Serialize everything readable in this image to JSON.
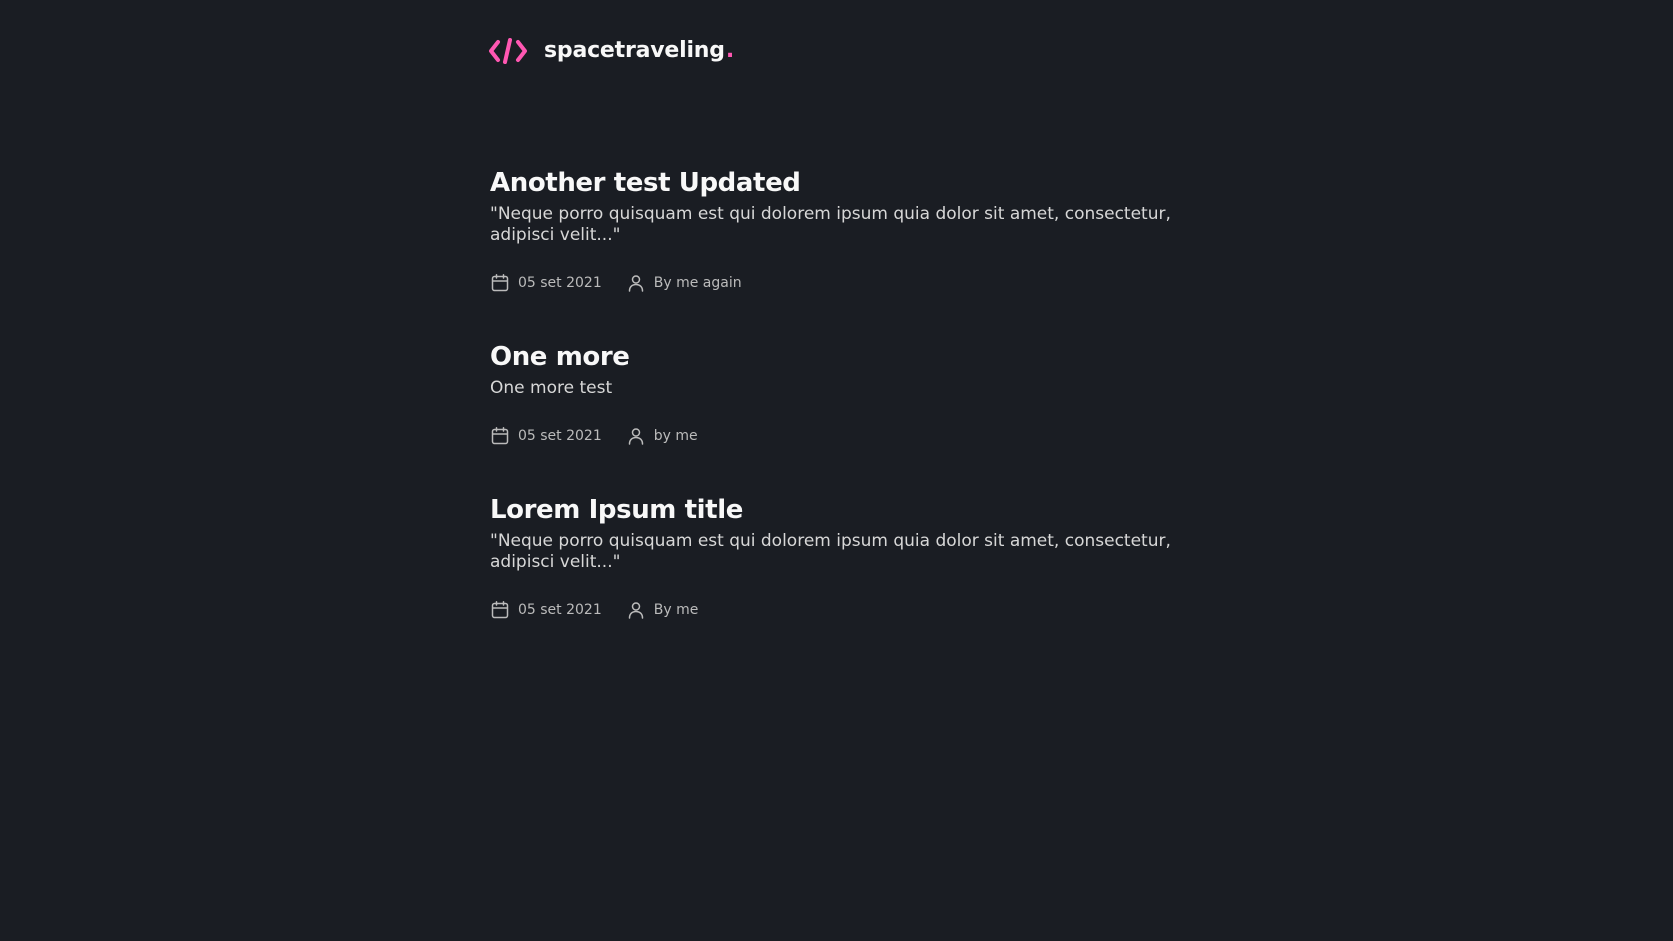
{
  "header": {
    "logo_text": "spacetraveling",
    "logo_dot": ".",
    "logo_icon": "code-brackets-icon",
    "accent_color": "#ff57b2"
  },
  "posts": [
    {
      "title": "Another test Updated",
      "subtitle": "\"Neque porro quisquam est qui dolorem ipsum quia dolor sit amet, consectetur, adipisci velit...\"",
      "date": "05 set 2021",
      "author": "By me again",
      "date_icon": "calendar-icon",
      "author_icon": "user-icon"
    },
    {
      "title": "One more",
      "subtitle": "One more test",
      "date": "05 set 2021",
      "author": "by me",
      "date_icon": "calendar-icon",
      "author_icon": "user-icon"
    },
    {
      "title": "Lorem Ipsum title",
      "subtitle": "\"Neque porro quisquam est qui dolorem ipsum quia dolor sit amet, consectetur, adipisci velit...\"",
      "date": "05 set 2021",
      "author": "By me",
      "date_icon": "calendar-icon",
      "author_icon": "user-icon"
    }
  ],
  "colors": {
    "background": "#1a1d23",
    "heading": "#f8f8f8",
    "body_text": "#d7d7d7",
    "info_text": "#bbbbbb",
    "accent": "#ff57b2"
  }
}
